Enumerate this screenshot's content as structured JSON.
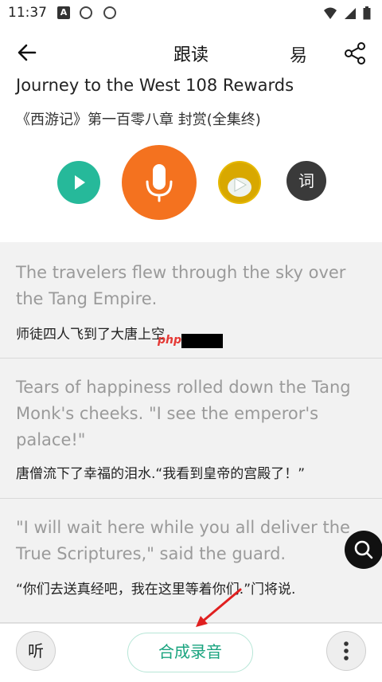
{
  "status_bar": {
    "time": "11:37",
    "a_icon": "A"
  },
  "header": {
    "title": "跟读",
    "easy_label": "易",
    "icons": {
      "back": "arrow-left-icon",
      "share": "share-icon"
    }
  },
  "lesson": {
    "title_en": "Journey to the West 108 Rewards",
    "title_cn": "《西游记》第一百零八章 封赏(全集终)"
  },
  "controls": {
    "play": "play-icon",
    "record": "microphone-icon",
    "cover_play": "play-icon",
    "word_label": "词",
    "colors": {
      "play": "#26b99a",
      "record": "#f4721f",
      "word": "#3a3a3a"
    }
  },
  "sentences": [
    {
      "en": "The travelers flew through the sky over the Tang Empire.",
      "cn": "师徒四人飞到了大唐上空"
    },
    {
      "en": "Tears of happiness rolled down the Tang Monk's cheeks. \"I see the emperor's palace!\"",
      "cn": "唐僧流下了幸福的泪水.“我看到皇帝的宫殿了！”"
    },
    {
      "en": "\"I will wait here while you all deliver the True Scriptures,\" said the guard.",
      "cn": "“你们去送真经吧，我在这里等着你们.”门将说."
    }
  ],
  "watermark": "php",
  "bottom_bar": {
    "listen_label": "听",
    "merge_label": "合成录音",
    "more_icon": "more-vertical-icon",
    "accent": "#1aa47f"
  }
}
